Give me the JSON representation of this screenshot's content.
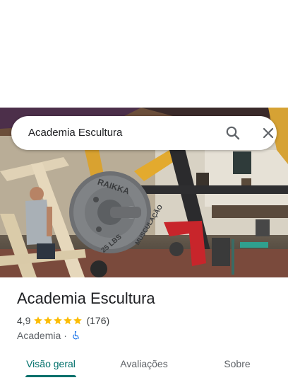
{
  "search": {
    "query": "Academia Escultura",
    "search_icon": "search-icon",
    "close_icon": "close-icon"
  },
  "place": {
    "name": "Academia Escultura",
    "rating": "4,9",
    "rating_value": 4.9,
    "reviews_count": "(176)",
    "category": "Academia",
    "separator": "·",
    "accessibility_icon": "wheelchair-accessible-icon"
  },
  "photo": {
    "plate_text_top": "RAIKKA",
    "plate_text_bottom": "25 LBS",
    "plate_text_side": "MUSCULAÇÃO"
  },
  "tabs": [
    {
      "label": "Visão geral",
      "active": true
    },
    {
      "label": "Avaliações",
      "active": false
    },
    {
      "label": "Sobre",
      "active": false
    }
  ],
  "colors": {
    "accent": "#00706b",
    "star": "#fbbc04",
    "accessibility": "#1a73e8"
  }
}
